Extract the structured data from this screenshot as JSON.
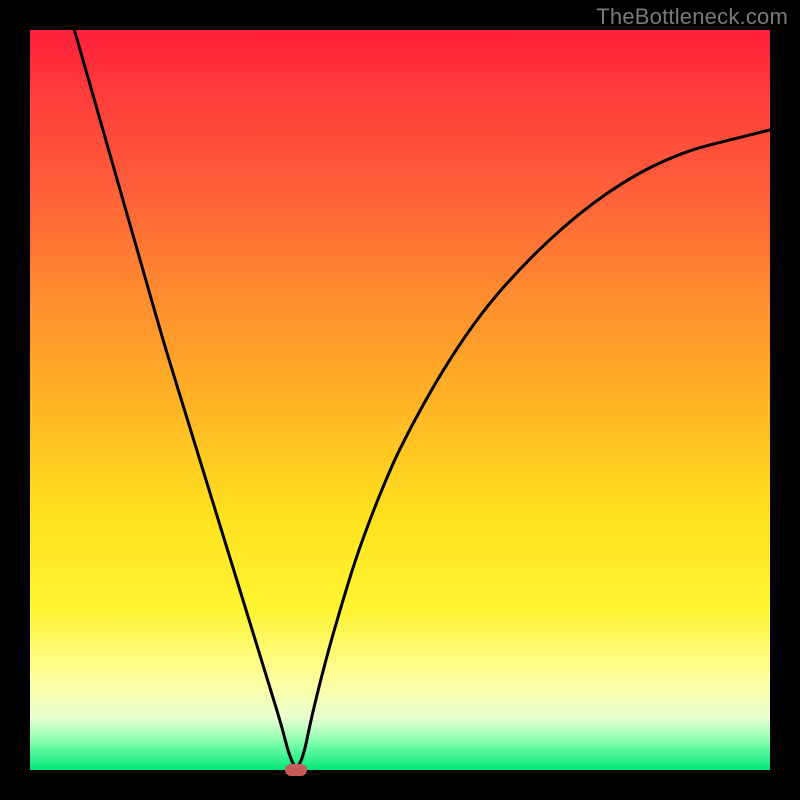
{
  "watermark": "TheBottleneck.com",
  "colors": {
    "frame": "#000000",
    "curve": "#000000",
    "marker": "#c85a5a",
    "gradient_top": "#ff1f3a",
    "gradient_bottom": "#00e878"
  },
  "chart_data": {
    "type": "line",
    "title": "",
    "xlabel": "",
    "ylabel": "",
    "xlim": [
      0,
      100
    ],
    "ylim": [
      0,
      100
    ],
    "x": [
      6,
      8,
      10,
      12,
      14,
      16,
      18,
      20,
      22,
      24,
      26,
      28,
      30,
      32,
      34,
      35,
      36,
      37,
      38,
      40,
      42,
      44,
      46,
      48,
      50,
      54,
      58,
      62,
      66,
      70,
      74,
      78,
      82,
      86,
      90,
      94,
      98,
      100
    ],
    "values": [
      100,
      93,
      86,
      79,
      72,
      65,
      58,
      51.5,
      45,
      38.5,
      32,
      25.5,
      19,
      12.5,
      6,
      2,
      0,
      2,
      7,
      15,
      22,
      28.5,
      34,
      39,
      43.5,
      51,
      57.5,
      63,
      67.5,
      71.5,
      75,
      78,
      80.5,
      82.5,
      84,
      85,
      86,
      86.5
    ],
    "annotations": [
      {
        "type": "marker",
        "x": 36,
        "y": 0,
        "shape": "pill"
      }
    ],
    "grid": false,
    "legend": false
  }
}
